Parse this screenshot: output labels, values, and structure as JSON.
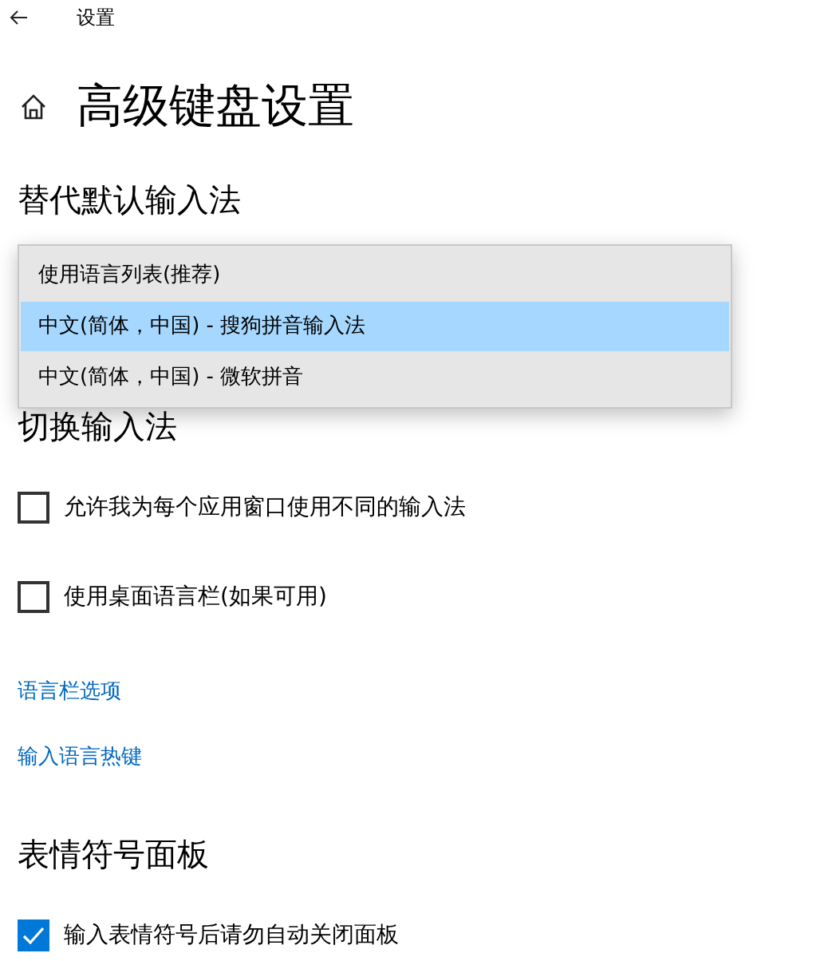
{
  "window": {
    "title": "设置"
  },
  "page": {
    "title": "高级键盘设置"
  },
  "sections": [
    {
      "heading": "替代默认输入法",
      "kind": "dropdown",
      "options": [
        {
          "label": "使用语言列表(推荐)",
          "selected": false
        },
        {
          "label": "中文(简体，中国) - 搜狗拼音输入法",
          "selected": true
        },
        {
          "label": "中文(简体，中国) - 微软拼音",
          "selected": false
        }
      ]
    },
    {
      "heading": "切换输入法",
      "kind": "settings",
      "checkboxes": [
        {
          "label": "允许我为每个应用窗口使用不同的输入法",
          "checked": false
        },
        {
          "label": "使用桌面语言栏(如果可用)",
          "checked": false
        }
      ],
      "links": [
        "语言栏选项",
        "输入语言热键"
      ]
    },
    {
      "heading": "表情符号面板",
      "kind": "settings",
      "checkboxes": [
        {
          "label": "输入表情符号后请勿自动关闭面板",
          "checked": true
        }
      ]
    }
  ]
}
